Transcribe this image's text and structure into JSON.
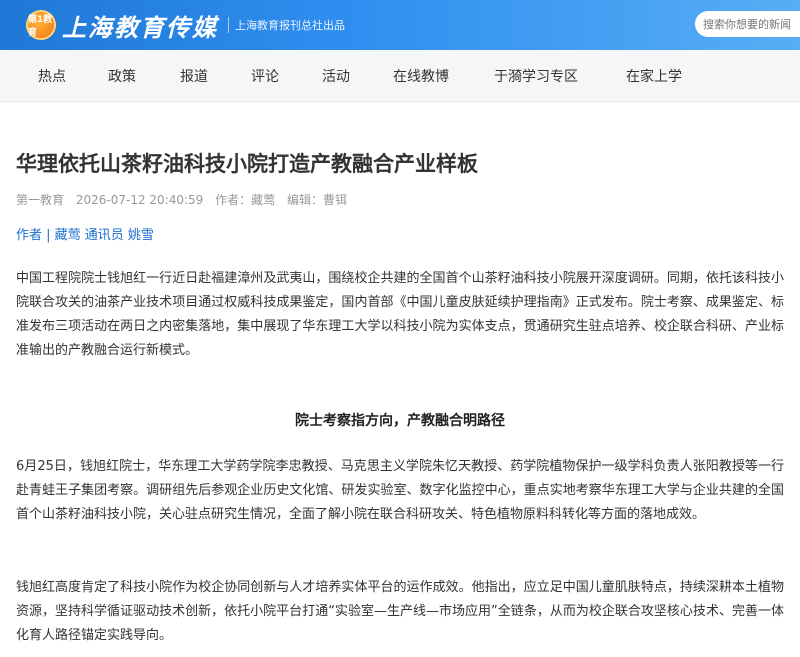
{
  "header": {
    "badge": "第1教育",
    "logo_title": "上海教育传媒",
    "logo_sub": "上海教育报刊总社出品",
    "search_placeholder": "搜索你想要的新闻"
  },
  "nav": {
    "items": [
      "热点",
      "政策",
      "报道",
      "评论",
      "活动",
      "在线教博",
      "于漪学习专区",
      "在家上学"
    ]
  },
  "article": {
    "title": "华理依托山茶籽油科技小院打造产教融合产业样板",
    "source": "第一教育",
    "datetime": "2026-07-12 20:40:59",
    "author_label": "作者：藏莺",
    "editor_label": "编辑：曹铒",
    "byline": "作者 | 藏莺 通讯员 姚雪",
    "intro": "中国工程院院士钱旭红一行近日赴福建漳州及武夷山，围绕校企共建的全国首个山茶籽油科技小院展开深度调研。同期，依托该科技小院联合攻关的油茶产业技术项目通过权威科技成果鉴定，国内首部《中国儿童皮肤延续护理指南》正式发布。院士考察、成果鉴定、标准发布三项活动在两日之内密集落地，集中展现了华东理工大学以科技小院为实体支点，贯通研究生驻点培养、校企联合科研、产业标准输出的产教融合运行新模式。",
    "section_heading": "院士考察指方向，产教融合明路径",
    "para1": "6月25日，钱旭红院士，华东理工大学药学院李忠教授、马克思主义学院朱忆天教授、药学院植物保护一级学科负责人张阳教授等一行赴青蛙王子集团考察。调研组先后参观企业历史文化馆、研发实验室、数字化监控中心，重点实地考察华东理工大学与企业共建的全国首个山茶籽油科技小院，关心驻点研究生情况，全面了解小院在联合科研攻关、特色植物原料科转化等方面的落地成效。",
    "para2": "钱旭红高度肯定了科技小院作为校企协同创新与人才培养实体平台的运作成效。他指出，应立足中国儿童肌肤特点，持续深耕本土植物资源，坚持科学循证驱动技术创新，依托小院平台打通“实验室—生产线—市场应用”全链条，从而为校企联合攻坚核心技术、完善一体化育人路径锚定实践导向。"
  }
}
